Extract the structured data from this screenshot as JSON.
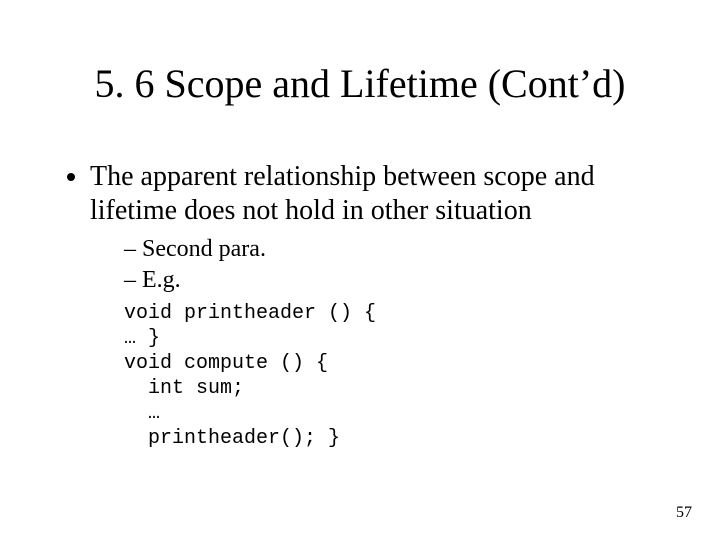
{
  "title": "5. 6 Scope and Lifetime (Cont’d)",
  "bullet1": "The apparent relationship between scope and lifetime does not hold in other situation",
  "sub1": "Second para.",
  "sub2": "E.g.",
  "code_lines": {
    "l1": "void printheader () {",
    "l2": "… }",
    "l3": "void compute () {",
    "l4": "  int sum;",
    "l5": "  …",
    "l6": "  printheader(); }"
  },
  "page_number": "57"
}
